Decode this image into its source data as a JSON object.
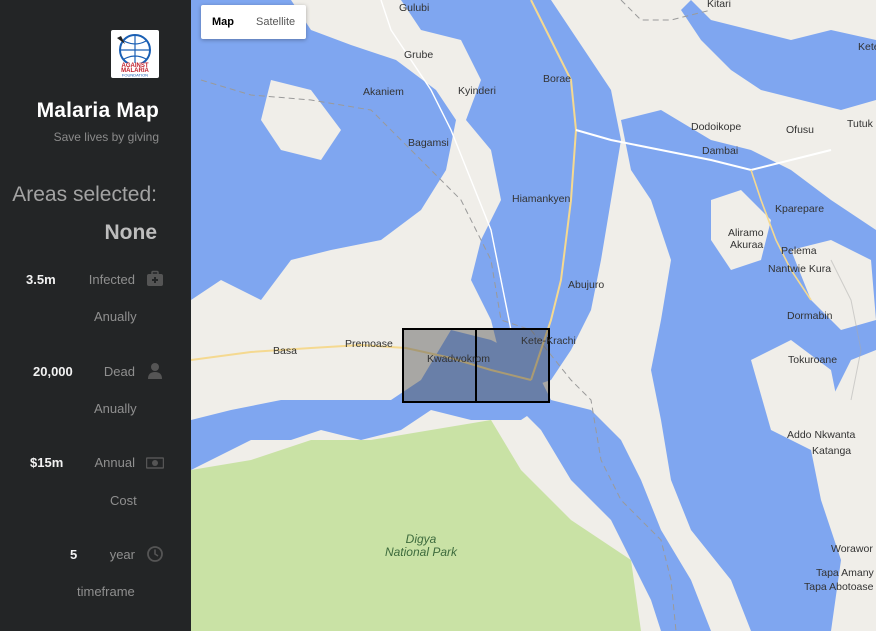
{
  "sidebar": {
    "logo_alt": "Against Malaria Foundation",
    "logo_lines": [
      "AGAINST",
      "MALARIA",
      "FOUNDATION"
    ],
    "app_title": "Malaria Map",
    "tagline": "Save lives by giving",
    "areas_label": "Areas selected:",
    "areas_value": "None",
    "stats": [
      {
        "value": "3.5m",
        "label": "Infected",
        "sub": "Anually",
        "icon": "medkit-icon"
      },
      {
        "value": "20,000",
        "label": "Dead",
        "sub": "Anually",
        "icon": "user-icon"
      },
      {
        "value": "$15m",
        "label": "Annual",
        "sub": "Cost",
        "icon": "money-icon"
      },
      {
        "value": "5",
        "label": "year",
        "sub": "timeframe",
        "icon": "clock-icon"
      }
    ]
  },
  "map": {
    "map_button": "Map",
    "satellite_button": "Satellite",
    "active_type": "Map",
    "water_color": "#7fa6f0",
    "park_color": "#c9e2a5",
    "land_color": "#f0eee9",
    "places": [
      "Gulubi",
      "Kitari",
      "Grube",
      "Akaniem",
      "Kyinderi",
      "Borae",
      "Kete",
      "Dodoikope",
      "Ofusu",
      "Tutuk",
      "Bagamsi",
      "Dambai",
      "Hiamankyen",
      "Kparepare",
      "Aliramo",
      "Akuraa",
      "Pelema",
      "Nantwie Kura",
      "Abujuro",
      "Dormabin",
      "Basa",
      "Premoase",
      "Kwadwokrom",
      "Kete-Krachi",
      "Tokuroane",
      "Addo Nkwanta",
      "Katanga",
      "Worawor",
      "Tapa Amany",
      "Tapa Abotoase"
    ],
    "park_name": [
      "Digya",
      "National Park"
    ]
  }
}
